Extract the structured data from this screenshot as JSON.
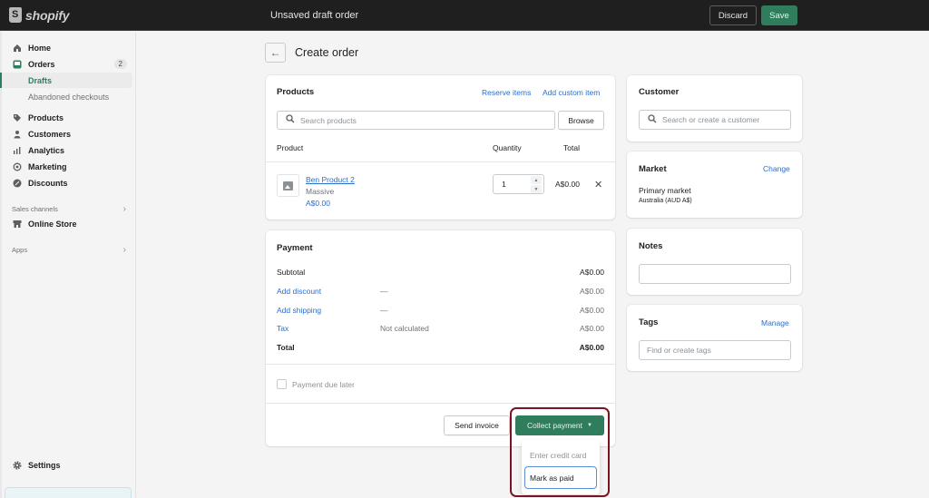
{
  "topbar": {
    "logo_text": "shopify",
    "title": "Unsaved draft order",
    "discard_label": "Discard",
    "save_label": "Save"
  },
  "sidebar": {
    "items": [
      {
        "label": "Home",
        "icon": "home-icon"
      },
      {
        "label": "Orders",
        "icon": "orders-icon",
        "badge": "2"
      },
      {
        "label": "Drafts",
        "sub": true,
        "active": true
      },
      {
        "label": "Abandoned checkouts",
        "sub": true
      },
      {
        "label": "Products",
        "icon": "tag-icon"
      },
      {
        "label": "Customers",
        "icon": "person-icon"
      },
      {
        "label": "Analytics",
        "icon": "bar-chart-icon"
      },
      {
        "label": "Marketing",
        "icon": "target-icon"
      },
      {
        "label": "Discounts",
        "icon": "discount-icon"
      }
    ],
    "sales_channels_label": "Sales channels",
    "online_store_label": "Online Store",
    "apps_label": "Apps",
    "settings_label": "Settings"
  },
  "page": {
    "title": "Create order"
  },
  "products_card": {
    "title": "Products",
    "reserve_items_label": "Reserve items",
    "add_custom_item_label": "Add custom item",
    "search_placeholder": "Search products",
    "browse_label": "Browse",
    "columns": [
      "Product",
      "Quantity",
      "Total"
    ],
    "line_items": [
      {
        "name": "Ben Product 2",
        "variant": "Massive",
        "price": "A$0.00",
        "quantity": "1",
        "total": "A$0.00"
      }
    ]
  },
  "payment_card": {
    "title": "Payment",
    "rows": [
      {
        "label": "Subtotal",
        "detail": "",
        "amount": "A$0.00"
      },
      {
        "label": "Add discount",
        "detail": "—",
        "amount": "A$0.00"
      },
      {
        "label": "Add shipping",
        "detail": "—",
        "amount": "A$0.00"
      },
      {
        "label": "Tax",
        "detail": "Not calculated",
        "amount": "A$0.00"
      },
      {
        "label": "Total",
        "detail": "",
        "amount": "A$0.00"
      }
    ],
    "payment_due_later_label": "Payment due later",
    "send_invoice_label": "Send invoice",
    "collect_payment_label": "Collect payment",
    "collect_menu": [
      "Enter credit card",
      "Mark as paid"
    ]
  },
  "customer_card": {
    "title": "Customer",
    "search_placeholder": "Search or create a customer"
  },
  "market_card": {
    "title": "Market",
    "change_label": "Change",
    "market_name": "Primary market",
    "market_detail": "Australia (AUD A$)"
  },
  "notes_card": {
    "title": "Notes",
    "value": ""
  },
  "tags_card": {
    "title": "Tags",
    "manage_label": "Manage",
    "placeholder": "Find or create tags"
  },
  "colors": {
    "brand_green": "#2f7d5d",
    "link_blue": "#2c6ecb",
    "highlight": "#7a1420",
    "topbar": "#1f1f1f"
  }
}
